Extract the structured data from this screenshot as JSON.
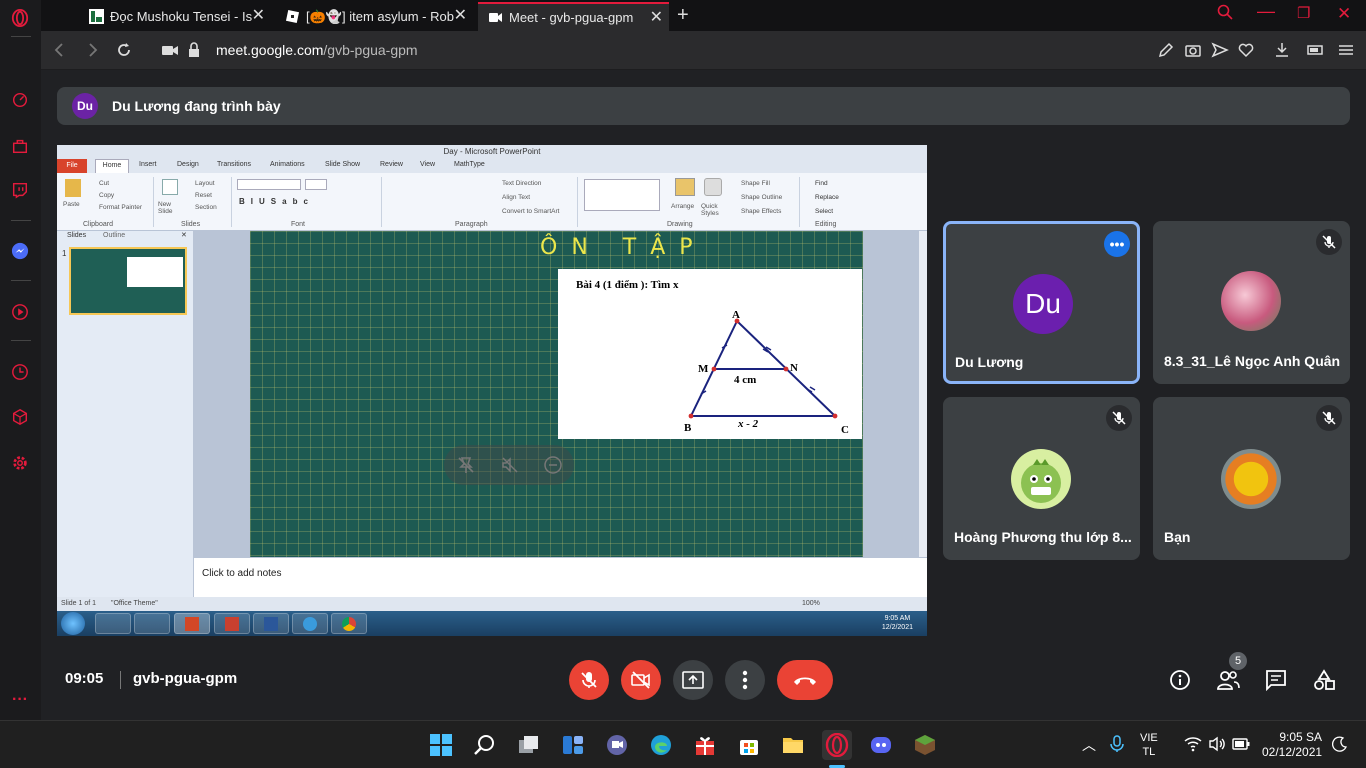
{
  "browser": {
    "tabs": [
      {
        "title": "Đọc Mushoku Tensei - Isekai",
        "icon": "book-icon"
      },
      {
        "title": "[🎃👻] item asylum - Roblox",
        "icon": "roblox-icon"
      },
      {
        "title": "Meet - gvb-pgua-gpm",
        "icon": "meet-icon"
      }
    ],
    "url_domain": "meet.google.com",
    "url_path": "/gvb-pgua-gpm",
    "accent": "#e31b3c"
  },
  "presenting_banner": {
    "avatar_initials": "Du",
    "text": "Du Lương đang trình bày"
  },
  "shared_screen": {
    "window_title": "Day - Microsoft PowerPoint",
    "ribbon_tabs": [
      "File",
      "Home",
      "Insert",
      "Design",
      "Transitions",
      "Animations",
      "Slide Show",
      "Review",
      "View",
      "MathType"
    ],
    "groups": [
      "Clipboard",
      "Slides",
      "Font",
      "Paragraph",
      "Drawing",
      "Editing"
    ],
    "clipboard_items": [
      "Paste",
      "Cut",
      "Copy",
      "Format Painter"
    ],
    "slides_items": [
      "New Slide",
      "Layout",
      "Reset",
      "Section"
    ],
    "paragraph_items": [
      "Text Direction",
      "Align Text",
      "Convert to SmartArt"
    ],
    "drawing_items": [
      "Arrange",
      "Quick Styles",
      "Shape Fill",
      "Shape Outline",
      "Shape Effects"
    ],
    "editing_items": [
      "Find",
      "Replace",
      "Select"
    ],
    "pane_tabs": [
      "Slides",
      "Outline"
    ],
    "slide_number": "1",
    "slide_heading": "ÔN TẬP",
    "problem": "Bài 4 (1 điểm ): Tìm x",
    "labels": {
      "A": "A",
      "B": "B",
      "C": "C",
      "M": "M",
      "N": "N",
      "mn": "4 cm",
      "bc": "x - 2"
    },
    "notes_placeholder": "Click to add notes",
    "status_slide": "Slide 1 of 1",
    "status_theme": "\"Office Theme\"",
    "zoom": "100%",
    "tb_time": "9:05 AM",
    "tb_date": "12/2/2021"
  },
  "participants": [
    {
      "name": "Du Lương",
      "initials": "Du",
      "active": true
    },
    {
      "name": "8.3_31_Lê Ngọc Anh Quân",
      "muted": true
    },
    {
      "name": "Hoàng Phương thu lớp 8...",
      "muted": true
    },
    {
      "name": "Bạn",
      "muted": true
    }
  ],
  "meeting": {
    "time": "09:05",
    "code": "gvb-pgua-gpm",
    "people_count": "5"
  },
  "windows": {
    "lang_top": "VIE",
    "lang_bottom": "TL",
    "time": "9:05 SA",
    "date": "02/12/2021"
  }
}
